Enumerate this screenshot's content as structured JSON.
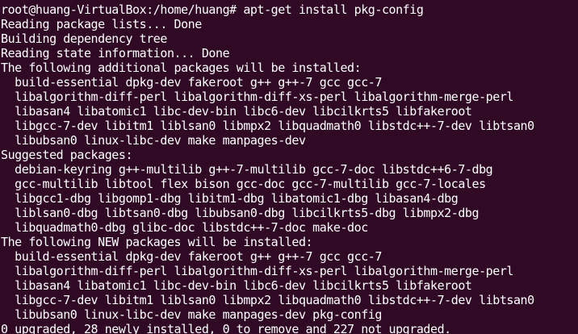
{
  "terminal": {
    "background_color": "#300a24",
    "text_color": "#ffffff",
    "lines": [
      "root@huang-VirtualBox:/home/huang# apt-get install pkg-config",
      "Reading package lists... Done",
      "Building dependency tree",
      "Reading state information... Done",
      "The following additional packages will be installed:",
      "  build-essential dpkg-dev fakeroot g++ g++-7 gcc gcc-7",
      "  libalgorithm-diff-perl libalgorithm-diff-xs-perl libalgorithm-merge-perl",
      "  libasan4 libatomic1 libc-dev-bin libc6-dev libcilkrts5 libfakeroot",
      "  libgcc-7-dev libitm1 liblsan0 libmpx2 libquadmath0 libstdc++-7-dev libtsan0",
      "  libubsan0 linux-libc-dev make manpages-dev",
      "Suggested packages:",
      "  debian-keyring g++-multilib g++-7-multilib gcc-7-doc libstdc++6-7-dbg",
      "  gcc-multilib libtool flex bison gcc-doc gcc-7-multilib gcc-7-locales",
      "  libgcc1-dbg libgomp1-dbg libitm1-dbg libatomic1-dbg libasan4-dbg",
      "  liblsan0-dbg libtsan0-dbg libubsan0-dbg libcilkrts5-dbg libmpx2-dbg",
      "  libquadmath0-dbg glibc-doc libstdc++-7-doc make-doc",
      "The following NEW packages will be installed:",
      "  build-essential dpkg-dev fakeroot g++ g++-7 gcc gcc-7",
      "  libalgorithm-diff-perl libalgorithm-diff-xs-perl libalgorithm-merge-perl",
      "  libasan4 libatomic1 libc-dev-bin libc6-dev libcilkrts5 libfakeroot",
      "  libgcc-7-dev libitm1 liblsan0 libmpx2 libquadmath0 libstdc++-7-dev libtsan0",
      "  libubsan0 linux-libc-dev make manpages-dev pkg-config",
      "0 upgraded, 28 newly installed, 0 to remove and 227 not upgraded."
    ]
  }
}
